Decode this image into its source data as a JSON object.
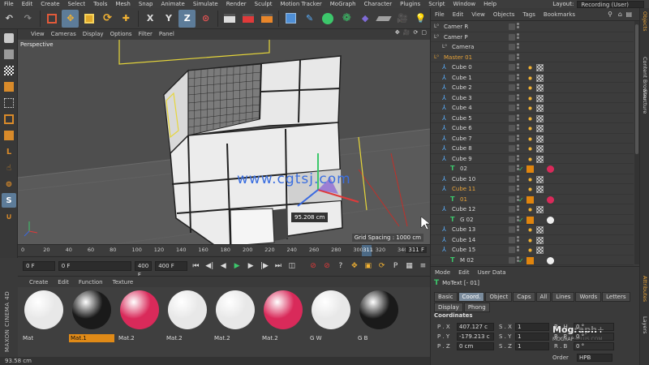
{
  "menubar": {
    "items": [
      "File",
      "Edit",
      "Create",
      "Select",
      "Tools",
      "Mesh",
      "Snap",
      "Animate",
      "Simulate",
      "Render",
      "Sculpt",
      "Motion Tracker",
      "MoGraph",
      "Character",
      "Plugins",
      "Script",
      "Window",
      "Help"
    ],
    "layout_label": "Layout:",
    "layout_value": "Recording (User)"
  },
  "viewport": {
    "menu": [
      "View",
      "Cameras",
      "Display",
      "Options",
      "Filter",
      "Panel"
    ],
    "label": "Perspective",
    "grid_spacing": "Grid Spacing : 1000 cm",
    "measure": "95.208 cm",
    "watermark": "www.cgtsj.com"
  },
  "timeline": {
    "ticks": [
      "0",
      "20",
      "40",
      "60",
      "80",
      "100",
      "120",
      "140",
      "160",
      "180",
      "200",
      "220",
      "240",
      "260",
      "280",
      "300",
      "320",
      "340"
    ],
    "playhead_frame": "311",
    "frame_indicator": "311 F"
  },
  "transport": {
    "start_frame": "0 F",
    "current_frame": "0 F",
    "end_frame_a": "400 F",
    "end_frame_b": "400 F"
  },
  "materials": {
    "menu": [
      "Create",
      "Edit",
      "Function",
      "Texture"
    ],
    "items": [
      {
        "label": "Mat",
        "color": "#e8e8e8",
        "active": false
      },
      {
        "label": "Mat.1",
        "color": "#1a1a1a",
        "active": true
      },
      {
        "label": "Mat.2",
        "color": "#d92a5a",
        "active": false
      },
      {
        "label": "Mat.2",
        "color": "#e8e8e8",
        "active": false
      },
      {
        "label": "Mat.2",
        "color": "#e8e8e8",
        "active": false
      },
      {
        "label": "Mat.2",
        "color": "#d92a5a",
        "active": false
      },
      {
        "label": "G W",
        "color": "#e8e8e8",
        "active": false
      },
      {
        "label": "G B",
        "color": "#1a1a1a",
        "active": false
      }
    ]
  },
  "statusbar": {
    "text": "93.58 cm"
  },
  "brand": {
    "text": "MAXON CINEMA 4D"
  },
  "object_manager": {
    "menu": [
      "File",
      "Edit",
      "View",
      "Objects",
      "Tags",
      "Bookmarks"
    ],
    "rows": [
      {
        "name": "Camer R",
        "indent": 0,
        "icon": "camera-icon",
        "hl": false
      },
      {
        "name": "Camer P",
        "indent": 0,
        "icon": "camera-icon",
        "hl": false
      },
      {
        "name": "Camera",
        "indent": 1,
        "icon": "camera-icon",
        "hl": false
      },
      {
        "name": "Master 01",
        "indent": 0,
        "icon": "null-icon",
        "hl": true
      },
      {
        "name": "Cube 0",
        "indent": 1,
        "icon": "cube-icon",
        "hl": false
      },
      {
        "name": "Cube 1",
        "indent": 1,
        "icon": "cube-icon",
        "hl": false
      },
      {
        "name": "Cube 2",
        "indent": 1,
        "icon": "cube-icon",
        "hl": false
      },
      {
        "name": "Cube 3",
        "indent": 1,
        "icon": "cube-icon",
        "hl": false
      },
      {
        "name": "Cube 4",
        "indent": 1,
        "icon": "cube-icon",
        "hl": false
      },
      {
        "name": "Cube 5",
        "indent": 1,
        "icon": "cube-icon",
        "hl": false
      },
      {
        "name": "Cube 6",
        "indent": 1,
        "icon": "cube-icon",
        "hl": false
      },
      {
        "name": "Cube 7",
        "indent": 1,
        "icon": "cube-icon",
        "hl": false
      },
      {
        "name": "Cube 8",
        "indent": 1,
        "icon": "cube-icon",
        "hl": false
      },
      {
        "name": "Cube 9",
        "indent": 1,
        "icon": "cube-icon",
        "hl": false
      },
      {
        "name": "02",
        "indent": 2,
        "icon": "text-icon",
        "hl": false
      },
      {
        "name": "Cube 10",
        "indent": 1,
        "icon": "cube-icon",
        "hl": false
      },
      {
        "name": "Cube 11",
        "indent": 1,
        "icon": "cube-icon",
        "hl": true
      },
      {
        "name": "01",
        "indent": 2,
        "icon": "text-icon",
        "hl": true
      },
      {
        "name": "Cube 12",
        "indent": 1,
        "icon": "cube-icon",
        "hl": false
      },
      {
        "name": "G 02",
        "indent": 2,
        "icon": "text-icon",
        "hl": false
      },
      {
        "name": "Cube 13",
        "indent": 1,
        "icon": "cube-icon",
        "hl": false
      },
      {
        "name": "Cube 14",
        "indent": 1,
        "icon": "cube-icon",
        "hl": false
      },
      {
        "name": "Cube 15",
        "indent": 1,
        "icon": "cube-icon",
        "hl": false
      },
      {
        "name": "M 02",
        "indent": 2,
        "icon": "text-icon",
        "hl": false
      }
    ]
  },
  "vertical_tabs": [
    "Objects",
    "Content Browser",
    "Structure",
    "Attributes",
    "Layers"
  ],
  "attributes": {
    "menu": [
      "Mode",
      "Edit",
      "User Data"
    ],
    "title": "MoText [- 01]",
    "tabs": [
      "Basic",
      "Coord.",
      "Object",
      "Caps",
      "All",
      "Lines",
      "Words",
      "Letters",
      "Display",
      "Phong"
    ],
    "active_tab": "Coord.",
    "section": "Coordinates",
    "rows": [
      {
        "p_label": "P . X",
        "p_value": "407.127 c",
        "s_label": "S . X",
        "s_value": "1",
        "r_label": "R . H",
        "r_value": "0 °"
      },
      {
        "p_label": "P . Y",
        "p_value": "-179.213 c",
        "s_label": "S . Y",
        "s_value": "1",
        "r_label": "R . P",
        "r_value": "0 °"
      },
      {
        "p_label": "P . Z",
        "p_value": "0 cm",
        "s_label": "S . Z",
        "s_value": "1",
        "r_label": "R . B",
        "r_value": "0 °"
      }
    ],
    "order_label": "Order",
    "order_value": "HPB",
    "logo": "Mograph+",
    "logo_sub": "MOGRAPHPLUS.COM"
  },
  "colors": {
    "accent_orange": "#e08a17",
    "selection_blue": "#5d7c99",
    "magenta": "#d92a5a"
  }
}
